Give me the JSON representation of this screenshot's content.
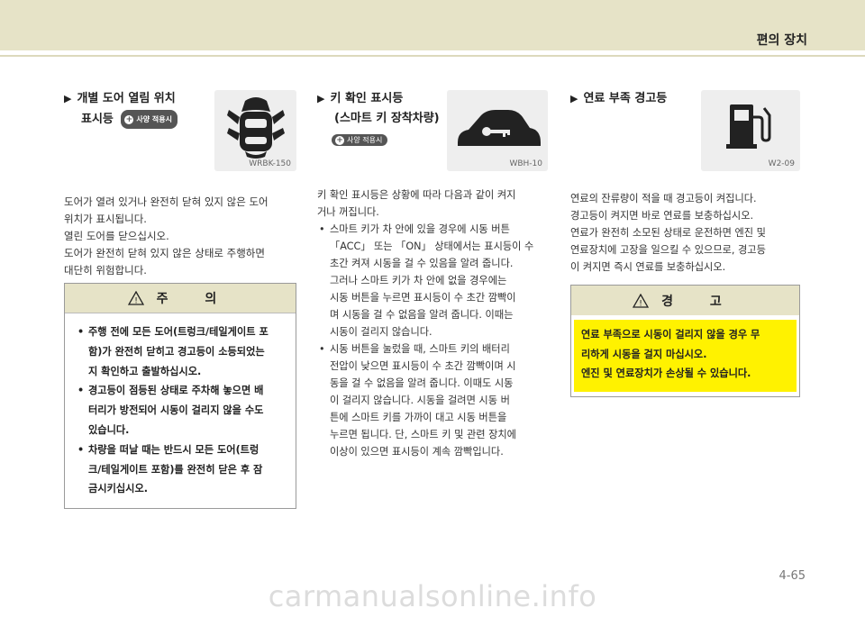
{
  "header": {
    "section_title": "편의 장치"
  },
  "col1": {
    "heading_line1": "개별 도어 열림 위치",
    "heading_line2": "표시등",
    "badge": "사양 적용시",
    "icon_name": "car-doors-open-icon",
    "icon_caption": "WRBK-150",
    "body": [
      "도어가 열려 있거나 완전히 닫혀 있지 않은 도어",
      "위치가 표시됩니다.",
      "열린 도어를 닫으십시오.",
      "도어가 완전히 닫혀 있지 않은 상태로 주행하면",
      "대단히 위험합니다."
    ],
    "caution": {
      "title": "주 의",
      "items": [
        [
          "주행 전에 모든 도어(트렁크/테일게이트 포",
          "함)가 완전히 닫히고 경고등이 소등되었는",
          "지 확인하고 출발하십시오."
        ],
        [
          "경고등이 점등된 상태로 주차해 놓으면 배",
          "터리가 방전되어 시동이 걸리지 않을 수도",
          "있습니다."
        ],
        [
          "차량을 떠날 때는 반드시 모든 도어(트렁",
          "크/테일게이트 포함)를 완전히 닫은 후 잠",
          "금시키십시오."
        ]
      ]
    }
  },
  "col2": {
    "heading_line1": "키 확인 표시등",
    "heading_line2": "(스마트 키 장착차량)",
    "badge": "사양 적용시",
    "icon_name": "car-key-icon",
    "icon_caption": "WBH-10",
    "intro": [
      "키 확인 표시등은 상황에 따라 다음과 같이 켜지",
      "거나 꺼집니다."
    ],
    "items": [
      [
        "스마트 키가 차 안에 있을 경우에 시동 버튼",
        "「ACC」 또는 「ON」 상태에서는 표시등이 수",
        "초간 켜져 시동을 걸 수 있음을 알려 줍니다.",
        "그러나 스마트 키가 차 안에 없을 경우에는",
        "시동 버튼을 누르면 표시등이 수 초간 깜빡이",
        "며 시동을 걸 수 없음을 알려 줍니다. 이때는",
        "시동이 걸리지 않습니다."
      ],
      [
        "시동 버튼을 눌렀을 때, 스마트 키의 배터리",
        "전압이 낮으면 표시등이 수 초간 깜빡이며 시",
        "동을 걸 수 없음을 알려 줍니다. 이때도 시동",
        "이 걸리지 않습니다. 시동을 걸려면 시동 버",
        "튼에 스마트 키를 가까이 대고 시동 버튼을",
        "누르면 됩니다. 단, 스마트 키 및 관련 장치에",
        "이상이 있으면 표시등이 계속 깜빡입니다."
      ]
    ]
  },
  "col3": {
    "heading_line1": "연료 부족 경고등",
    "icon_name": "fuel-pump-icon",
    "icon_caption": "W2-09",
    "body": [
      "연료의 잔류량이 적을 때 경고등이 켜집니다.",
      "경고등이 켜지면 바로 연료를 보충하십시오.",
      "연료가 완전히 소모된 상태로 운전하면 엔진 및",
      "연료장치에 고장을 일으킬 수 있으므로, 경고등",
      "이 켜지면 즉시 연료를 보충하십시오."
    ],
    "warning": {
      "title": "경 고",
      "lines": [
        "연료 부족으로 시동이 걸리지 않을 경우 무",
        "리하게 시동을 걸지 마십시오.",
        "엔진 및 연료장치가 손상될 수 있습니다."
      ]
    }
  },
  "footer": {
    "page_number": "4-65",
    "watermark": "carmanualsonline.info"
  }
}
